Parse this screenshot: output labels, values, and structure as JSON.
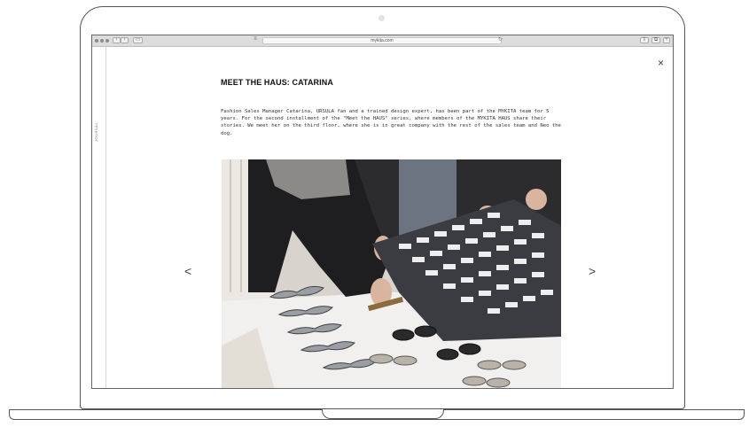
{
  "browser": {
    "url": "mykita.com",
    "sidebar_label": "JOURNAL"
  },
  "article": {
    "title": "MEET THE HAUS: CATARINA",
    "body": "Fashion Sales Manager Catarina, URSULA fan and a trained design expert, has been part of the MYKITA team for 5 years. For the second installment of the \"Meet the HAUS\" series, where members of the MYKITA HAUS share their stories. We meet her on the third floor, where she is in great company with the rest of the sales team and Neo the dog."
  },
  "icons": {
    "close": "×",
    "prev": "<",
    "next": ">"
  },
  "colors": {
    "toolbar": "#dcdcdc",
    "text": "#333333",
    "frame": "#555555"
  }
}
